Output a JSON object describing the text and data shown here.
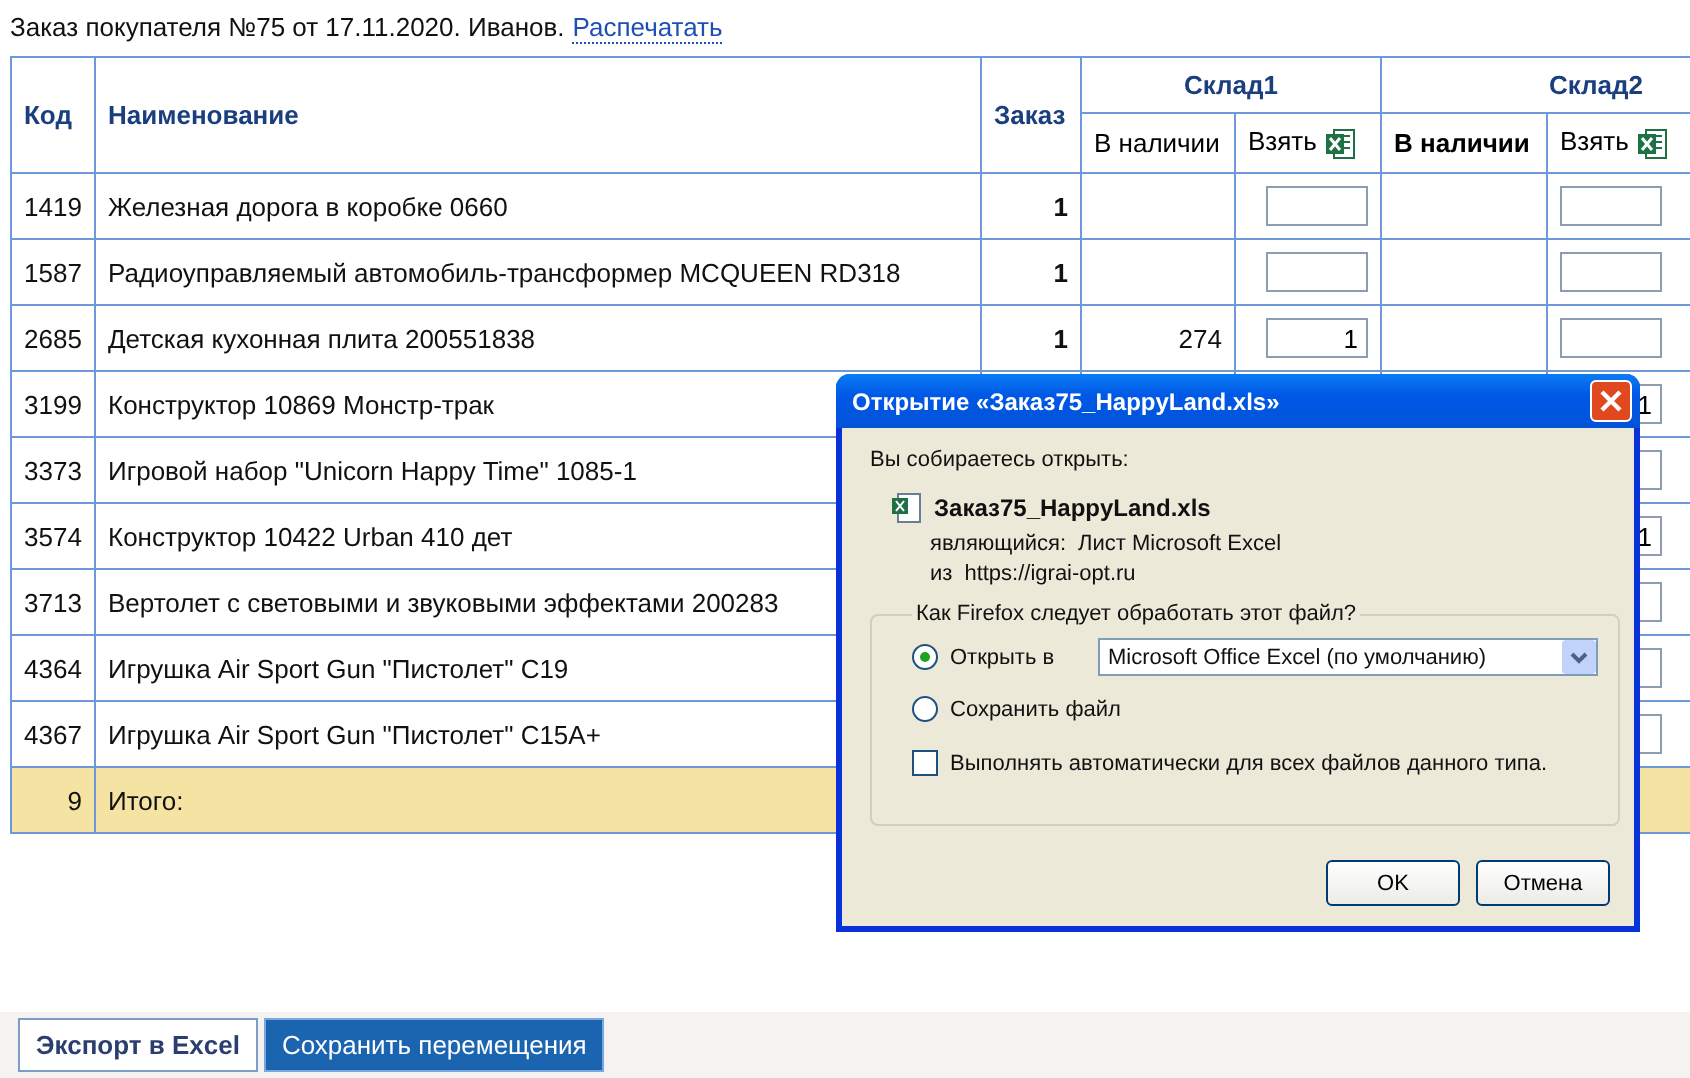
{
  "heading": {
    "text": "Заказ покупателя №75 от 17.11.2020. Иванов.",
    "link": "Распечатать"
  },
  "table": {
    "columns": [
      "Код",
      "Наименование",
      "Заказ"
    ],
    "warehouses": [
      {
        "name": "Склад1",
        "sub_columns": [
          {
            "label": "В наличии",
            "active": false
          },
          {
            "label": "Взять",
            "active": false
          }
        ]
      },
      {
        "name": "Склад2",
        "sub_columns": [
          {
            "label": "В наличии",
            "active": true
          },
          {
            "label": "Взять",
            "active": false
          }
        ]
      }
    ],
    "rows": [
      {
        "code": "1419",
        "name": "Железная дорога в коробке 0660",
        "order": "1",
        "covered": false
      },
      {
        "code": "1587",
        "name": "Радиоуправляемый автомобиль-трансформер MCQUEEN RD318",
        "order": "1",
        "covered": false
      },
      {
        "code": "2685",
        "name": "Детская кухонная плита 200551838",
        "order": "1",
        "stock1": "274",
        "take1": "1",
        "covered": false
      },
      {
        "code": "3199",
        "name": "Конструктор 10869 Монстр-трак",
        "take2": "1",
        "covered": true
      },
      {
        "code": "3373",
        "name": "Игровой набор \"Unicorn Happy Time\" 1085-1",
        "covered": true
      },
      {
        "code": "3574",
        "name": "Конструктор 10422 Urban 410 дет",
        "take2": "1",
        "covered": true
      },
      {
        "code": "3713",
        "name": "Вертолет с световыми и звуковыми эффектами 200283",
        "covered": true
      },
      {
        "code": "4364",
        "name": "Игрушка Air Sport Gun \"Пистолет\" C19",
        "covered": true
      },
      {
        "code": "4367",
        "name": "Игрушка Air Sport Gun \"Пистолет\" C15A+",
        "covered": true
      }
    ],
    "total": {
      "count": "9",
      "label": "Итого:"
    }
  },
  "dialog": {
    "title": "Открытие «Заказ75_HappyLand.xls»",
    "intro": "Вы собираетесь открыть:",
    "file_name": "Заказ75_HappyLand.xls",
    "type_label": "являющийся:",
    "type_value": "Лист Microsoft Excel",
    "from_label": "из",
    "from_value": "https://igrai-opt.ru",
    "group_title": "Как Firefox следует обработать этот файл?",
    "options": [
      {
        "label": "Открыть в",
        "selected": true,
        "app": "Microsoft Office Excel (по умолчанию)"
      },
      {
        "label": "Сохранить файл",
        "selected": false
      }
    ],
    "auto": {
      "label": "Выполнять автоматически для всех файлов данного типа.",
      "checked": false
    },
    "buttons": [
      "OK",
      "Отмена"
    ]
  },
  "footer": {
    "buttons": [
      {
        "label": "Экспорт в Excel",
        "primary": false
      },
      {
        "label": "Сохранить перемещения",
        "primary": true
      }
    ]
  }
}
